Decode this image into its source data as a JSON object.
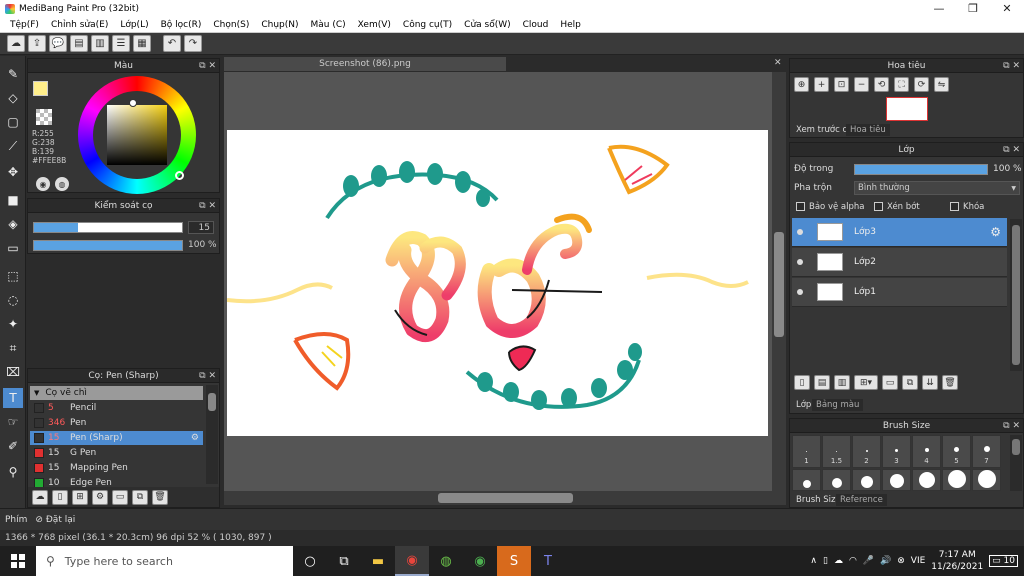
{
  "window": {
    "title": "MediBang Paint Pro (32bit)"
  },
  "menu": [
    "Tệp(F)",
    "Chỉnh sửa(E)",
    "Lớp(L)",
    "Bộ lọc(R)",
    "Chọn(S)",
    "Chụp(N)",
    "Màu (C)",
    "Xem(V)",
    "Công cụ(T)",
    "Cửa sổ(W)",
    "Cloud",
    "Help"
  ],
  "color_panel": {
    "title": "Màu",
    "rgb_r": "R:255",
    "rgb_g": "G:238",
    "rgb_b": "B:139",
    "hex": "#FFEE8B",
    "foreground": "#ffee8b",
    "background": "#cc2222"
  },
  "brush_control": {
    "title": "Kiểm soát cọ",
    "size_value": "15",
    "size_fraction": 0.3,
    "opacity_value": "100 %",
    "opacity_fraction": 1.0
  },
  "brush_list": {
    "title": "Cọ: Pen (Sharp)",
    "category": "Cọ vẽ chì",
    "items": [
      {
        "size": "5",
        "name": "Pencil",
        "color": "#333333",
        "size_color": "#ff5a5a"
      },
      {
        "size": "346",
        "name": "Pen",
        "color": "#333333",
        "size_color": "#ff5a5a"
      },
      {
        "size": "15",
        "name": "Pen (Sharp)",
        "color": "#333333",
        "size_color": "#ff7a7a",
        "selected": true
      },
      {
        "size": "15",
        "name": "G Pen",
        "color": "#e03030",
        "size_color": "#dddddd"
      },
      {
        "size": "15",
        "name": "Mapping Pen",
        "color": "#e03030",
        "size_color": "#dddddd"
      },
      {
        "size": "10",
        "name": "Edge Pen",
        "color": "#22aa33",
        "size_color": "#dddddd"
      }
    ]
  },
  "document": {
    "tab": "Screenshot (86).png"
  },
  "navigator": {
    "title": "Hoa tiêu",
    "tab_preview": "Xem trước cọ",
    "tab_nav": "Hoa tiêu"
  },
  "layer_panel": {
    "title": "Lớp",
    "opacity_label": "Độ trong",
    "opacity_value": "100 %",
    "opacity_fraction": 1.0,
    "blend_label": "Pha trộn",
    "blend_value": "Bình thường",
    "protect_alpha": "Bảo vệ alpha",
    "clipping": "Xén bớt",
    "lock": "Khóa",
    "layers": [
      {
        "name": "Lớp3",
        "selected": true
      },
      {
        "name": "Lớp2",
        "selected": false
      },
      {
        "name": "Lớp1",
        "selected": false
      }
    ],
    "tab_layer": "Lớp",
    "tab_palette": "Bảng màu"
  },
  "brush_size": {
    "title": "Brush Size",
    "row1": [
      "1",
      "1.5",
      "2",
      "3",
      "4",
      "5",
      "7"
    ],
    "tab_size": "Brush Size",
    "tab_ref": "Reference"
  },
  "bottom": {
    "phim": "Phím",
    "reset": "Đặt lại"
  },
  "status": "1366 * 768 pixel  (36.1 * 20.3cm)  96 dpi  52 %  ( 1030, 897 )",
  "taskbar": {
    "search_placeholder": "Type here to search",
    "lang": "VIE",
    "time": "7:17 AM",
    "date": "11/26/2021",
    "notif": "10"
  }
}
